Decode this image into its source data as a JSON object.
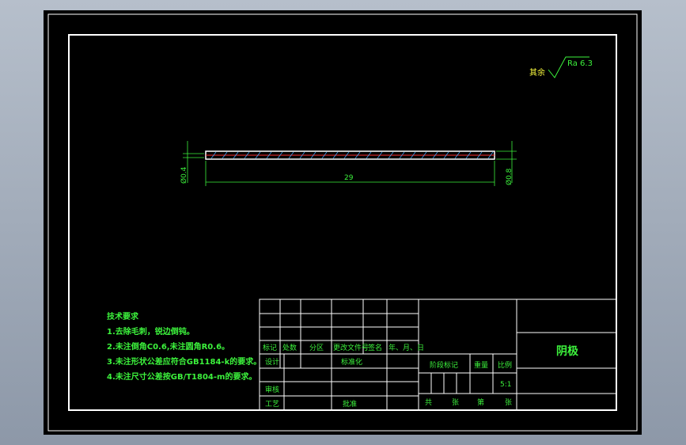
{
  "colors": {
    "background": "#000000",
    "frame": "#ffffff",
    "green": "#3cf23c",
    "dim": "#1fd11f",
    "cyan": "#40a8ff",
    "red": "#ff3030",
    "yellow": "#ffff40"
  },
  "roughness": {
    "prefix": "其余",
    "value": "Ra 6.3"
  },
  "dimensions": {
    "length": "29",
    "left_dia": "Ø0.4",
    "right_dia": "Ø0.8"
  },
  "notes": {
    "title": "技术要求",
    "items": [
      "1.去除毛刺，锐边倒钝。",
      "2.未注倒角C0.6,未注圆角R0.6。",
      "3.未注形状公差应符合GB1184-k的要求。",
      "4.未注尺寸公差按GB/T1804-m的要求。"
    ]
  },
  "titleblock": {
    "rev_headers": [
      "标记",
      "处数",
      "分区",
      "更改文件号",
      "签名",
      "年、月、日"
    ],
    "design": "设计",
    "standard": "标准化",
    "review": "审核",
    "process": "工艺",
    "approve": "批准",
    "stage": "阶段标记",
    "weight": "重量",
    "scale_label": "比例",
    "scale": "5:1",
    "total": "共",
    "sheets": "张",
    "sheet_no": "第",
    "sheet_unit": "张",
    "part_name": "阴极"
  }
}
